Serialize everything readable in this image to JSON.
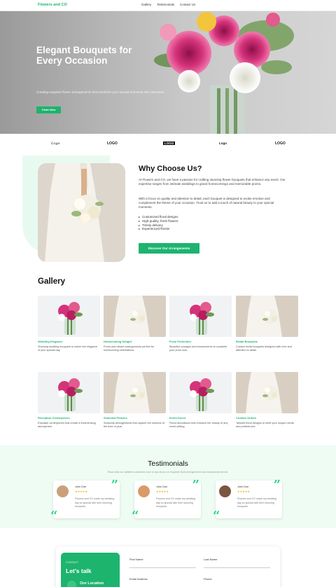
{
  "nav": {
    "brand": "Flowers and CO",
    "links": [
      "Gallery",
      "Testimonials",
      "Contact Us"
    ]
  },
  "hero": {
    "title": "Elegant Bouquets for Every Occasion",
    "subtitle": "Creating exquisite flower arrangements that transform your special moments into memories.",
    "cta": "Order Now"
  },
  "logos": [
    "Logo",
    "LOGO",
    "LOGO",
    "Logo",
    "LOGO"
  ],
  "why": {
    "title": "Why Choose Us?",
    "p1": "At Flowers and CO, we have a passion for crafting stunning flower bouquets that enhance any event. Our expertise ranges from intimate weddings to grand homecomings and memorable proms.",
    "p2": "With a focus on quality and attention to detail, each bouquet is designed to evoke emotion and complement the theme of your occasion. Trust us to add a touch of natural beauty to your special moments.",
    "list": [
      "Customized floral designs",
      "High-quality, fresh flowers",
      "Timely delivery",
      "Experienced florists"
    ],
    "cta": "Discover Our Arrangements"
  },
  "gallery": {
    "title": "Gallery",
    "items": [
      {
        "title": "Wedding Elegance",
        "desc": "Stunning wedding bouquets to match the elegance of your special day.",
        "image": "vase-flowers"
      },
      {
        "title": "Homecoming Delight",
        "desc": "Fresh and vibrant arrangements perfect for homecoming celebrations.",
        "image": "bride-bouquet"
      },
      {
        "title": "Prom Perfection",
        "desc": "Beautiful corsages and boutonnieres to complete your prom look.",
        "image": "vase-flowers"
      },
      {
        "title": "Bridal Bouquets",
        "desc": "Custom bridal bouquets designed with love and attention to detail.",
        "image": "bride-bouquet"
      },
      {
        "title": "Reception Centerpieces",
        "desc": "Exquisite centerpieces that create a mesmerizing atmosphere.",
        "image": "vase-flowers"
      },
      {
        "title": "Seasonal Flowers",
        "desc": "Seasonal arrangements that capture the essence of the time of year.",
        "image": "bride-bouquet"
      },
      {
        "title": "Event Decor",
        "desc": "Floral decorations that enhance the beauty of any event setting.",
        "image": "vase-flowers"
      },
      {
        "title": "Custom Orders",
        "desc": "Tailored floral designs to meet your unique needs and preferences.",
        "image": "bride-bouquet"
      }
    ]
  },
  "testimonials": {
    "title": "Testimonials",
    "subtitle": "Read what our satisfied customers have to say about our exquisite floral arrangements and exceptional service.",
    "items": [
      {
        "name": "John Doe",
        "stars": "★★★★★",
        "text": "Flowers and CO made my wedding day so special with their stunning bouquets."
      },
      {
        "name": "John Doe",
        "stars": "★★★★★",
        "text": "Flowers and CO made my wedding day so special with their stunning bouquets."
      },
      {
        "name": "John Doe",
        "stars": "★★★★★",
        "text": "Flowers and CO made my wedding day so special with their stunning bouquets."
      }
    ]
  },
  "contact": {
    "label": "CONTACT",
    "heading": "Let's talk",
    "location": "Our Location",
    "fields": [
      "First Name",
      "Last Name",
      "Email Address",
      "Phone"
    ]
  },
  "colors": {
    "accent": "#1db46e",
    "quote": "#2fd38a",
    "star": "#f0b400"
  }
}
